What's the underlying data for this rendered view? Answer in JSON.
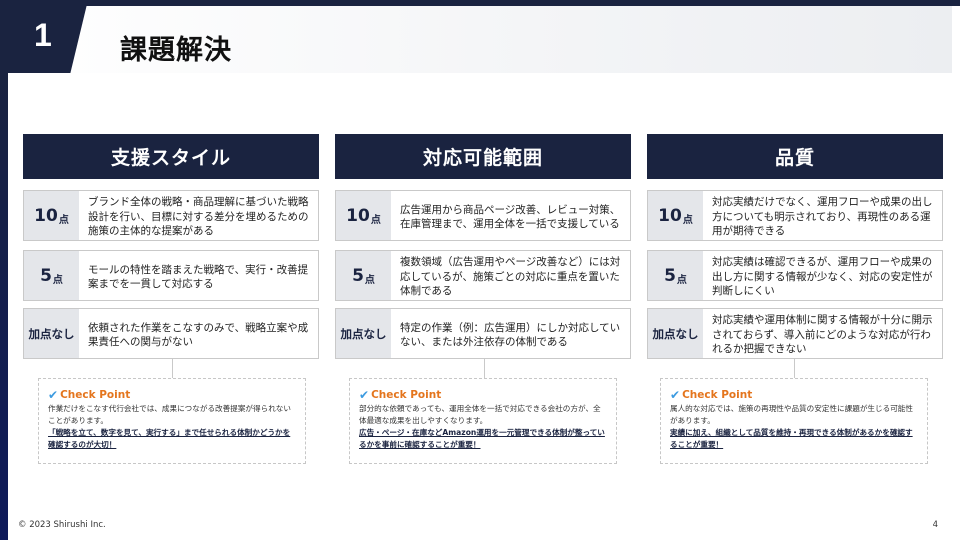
{
  "header": {
    "number": "1",
    "title": "課題解決"
  },
  "columns": [
    {
      "title": "支援スタイル",
      "rows": [
        {
          "score": "10",
          "unit": "点",
          "text": "ブランド全体の戦略・商品理解に基づいた戦略設計を行い、目標に対する差分を埋めるための施策の主体的な提案がある"
        },
        {
          "score": "5",
          "unit": "点",
          "text": "モールの特性を踏まえた戦略で、実行・改善提案までを一貫して対応する"
        },
        {
          "score": "加点なし",
          "unit": "",
          "text": "依頼された作業をこなすのみで、戦略立案や成果責任への関与がない"
        }
      ],
      "checkpoint": {
        "title": "Check Point",
        "text": "作業だけをこなす代行会社では、成果につながる改善提案が得られないことがあります。",
        "highlight": "「戦略を立て、数字を見て、実行する」まで任せられる体制かどうかを確認するのが大切！"
      }
    },
    {
      "title": "対応可能範囲",
      "rows": [
        {
          "score": "10",
          "unit": "点",
          "text": "広告運用から商品ページ改善、レビュー対策、在庫管理まで、運用全体を一括で支援している"
        },
        {
          "score": "5",
          "unit": "点",
          "text": "複数領域（広告運用やページ改善など）には対応しているが、施策ごとの対応に重点を置いた体制である"
        },
        {
          "score": "加点なし",
          "unit": "",
          "text": "特定の作業（例：広告運用）にしか対応していない、または外注依存の体制である"
        }
      ],
      "checkpoint": {
        "title": "Check Point",
        "text": "部分的な依頼であっても、運用全体を一括で対応できる会社の方が、全体最適な成果を出しやすくなります。",
        "highlight": "広告・ページ・在庫などAmazon運用を一元管理できる体制が整っているかを事前に確認することが重要！"
      }
    },
    {
      "title": "品質",
      "rows": [
        {
          "score": "10",
          "unit": "点",
          "text": "対応実績だけでなく、運用フローや成果の出し方についても明示されており、再現性のある運用が期待できる"
        },
        {
          "score": "5",
          "unit": "点",
          "text": "対応実績は確認できるが、運用フローや成果の出し方に関する情報が少なく、対応の安定性が判断しにくい"
        },
        {
          "score": "加点なし",
          "unit": "",
          "text": "対応実績や運用体制に関する情報が十分に開示されておらず、導入前にどのような対応が行われるか把握できない"
        }
      ],
      "checkpoint": {
        "title": "Check Point",
        "text": "属人的な対応では、施策の再現性や品質の安定性に課題が生じる可能性があります。",
        "highlight": "実績に加え、組織として品質を維持・再現できる体制があるかを確認することが重要！"
      }
    }
  ],
  "footer": {
    "copyright": "© 2023 Shirushi Inc.",
    "page": "4"
  },
  "icons": {
    "checkpoint": "check-icon"
  },
  "colors": {
    "navy": "#1a2340",
    "accent": "#e4751d",
    "score_bg": "#e4e6ea"
  }
}
